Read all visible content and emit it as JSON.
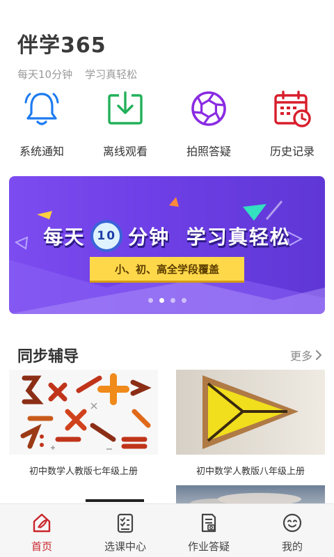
{
  "header": {
    "title": "伴学365",
    "slogan_1": "每天10分钟",
    "slogan_2": "学习真轻松"
  },
  "quick_actions": [
    {
      "label": "系统通知",
      "icon": "bell-icon",
      "color": "#1d7bf0"
    },
    {
      "label": "离线观看",
      "icon": "download-icon",
      "color": "#22b05a"
    },
    {
      "label": "拍照答疑",
      "icon": "camera-aperture-icon",
      "color": "#8a2be2"
    },
    {
      "label": "历史记录",
      "icon": "calendar-clock-icon",
      "color": "#d81e2c"
    }
  ],
  "banner": {
    "headline_part1": "每天",
    "clock_number": "10",
    "headline_part2": "分钟  学习真轻松",
    "ribbon": "小、初、高全学段覆盖",
    "slide_count": 4,
    "active_slide_index": 1
  },
  "sync_section": {
    "title": "同步辅导",
    "more": "更多"
  },
  "courses": [
    {
      "caption": "初中数学人教版七年级上册"
    },
    {
      "caption": "初中数学人教版八年级上册"
    }
  ],
  "tabbar": [
    {
      "label": "首页",
      "icon": "home-icon",
      "active": true
    },
    {
      "label": "选课中心",
      "icon": "checklist-icon",
      "active": false
    },
    {
      "label": "作业答疑",
      "icon": "homework-doc-icon",
      "active": false
    },
    {
      "label": "我的",
      "icon": "smiley-icon",
      "active": false
    }
  ],
  "colors": {
    "accent_red": "#c9252b",
    "banner_purple": "#6e3fe6",
    "ribbon_yellow": "#ffd84a"
  }
}
